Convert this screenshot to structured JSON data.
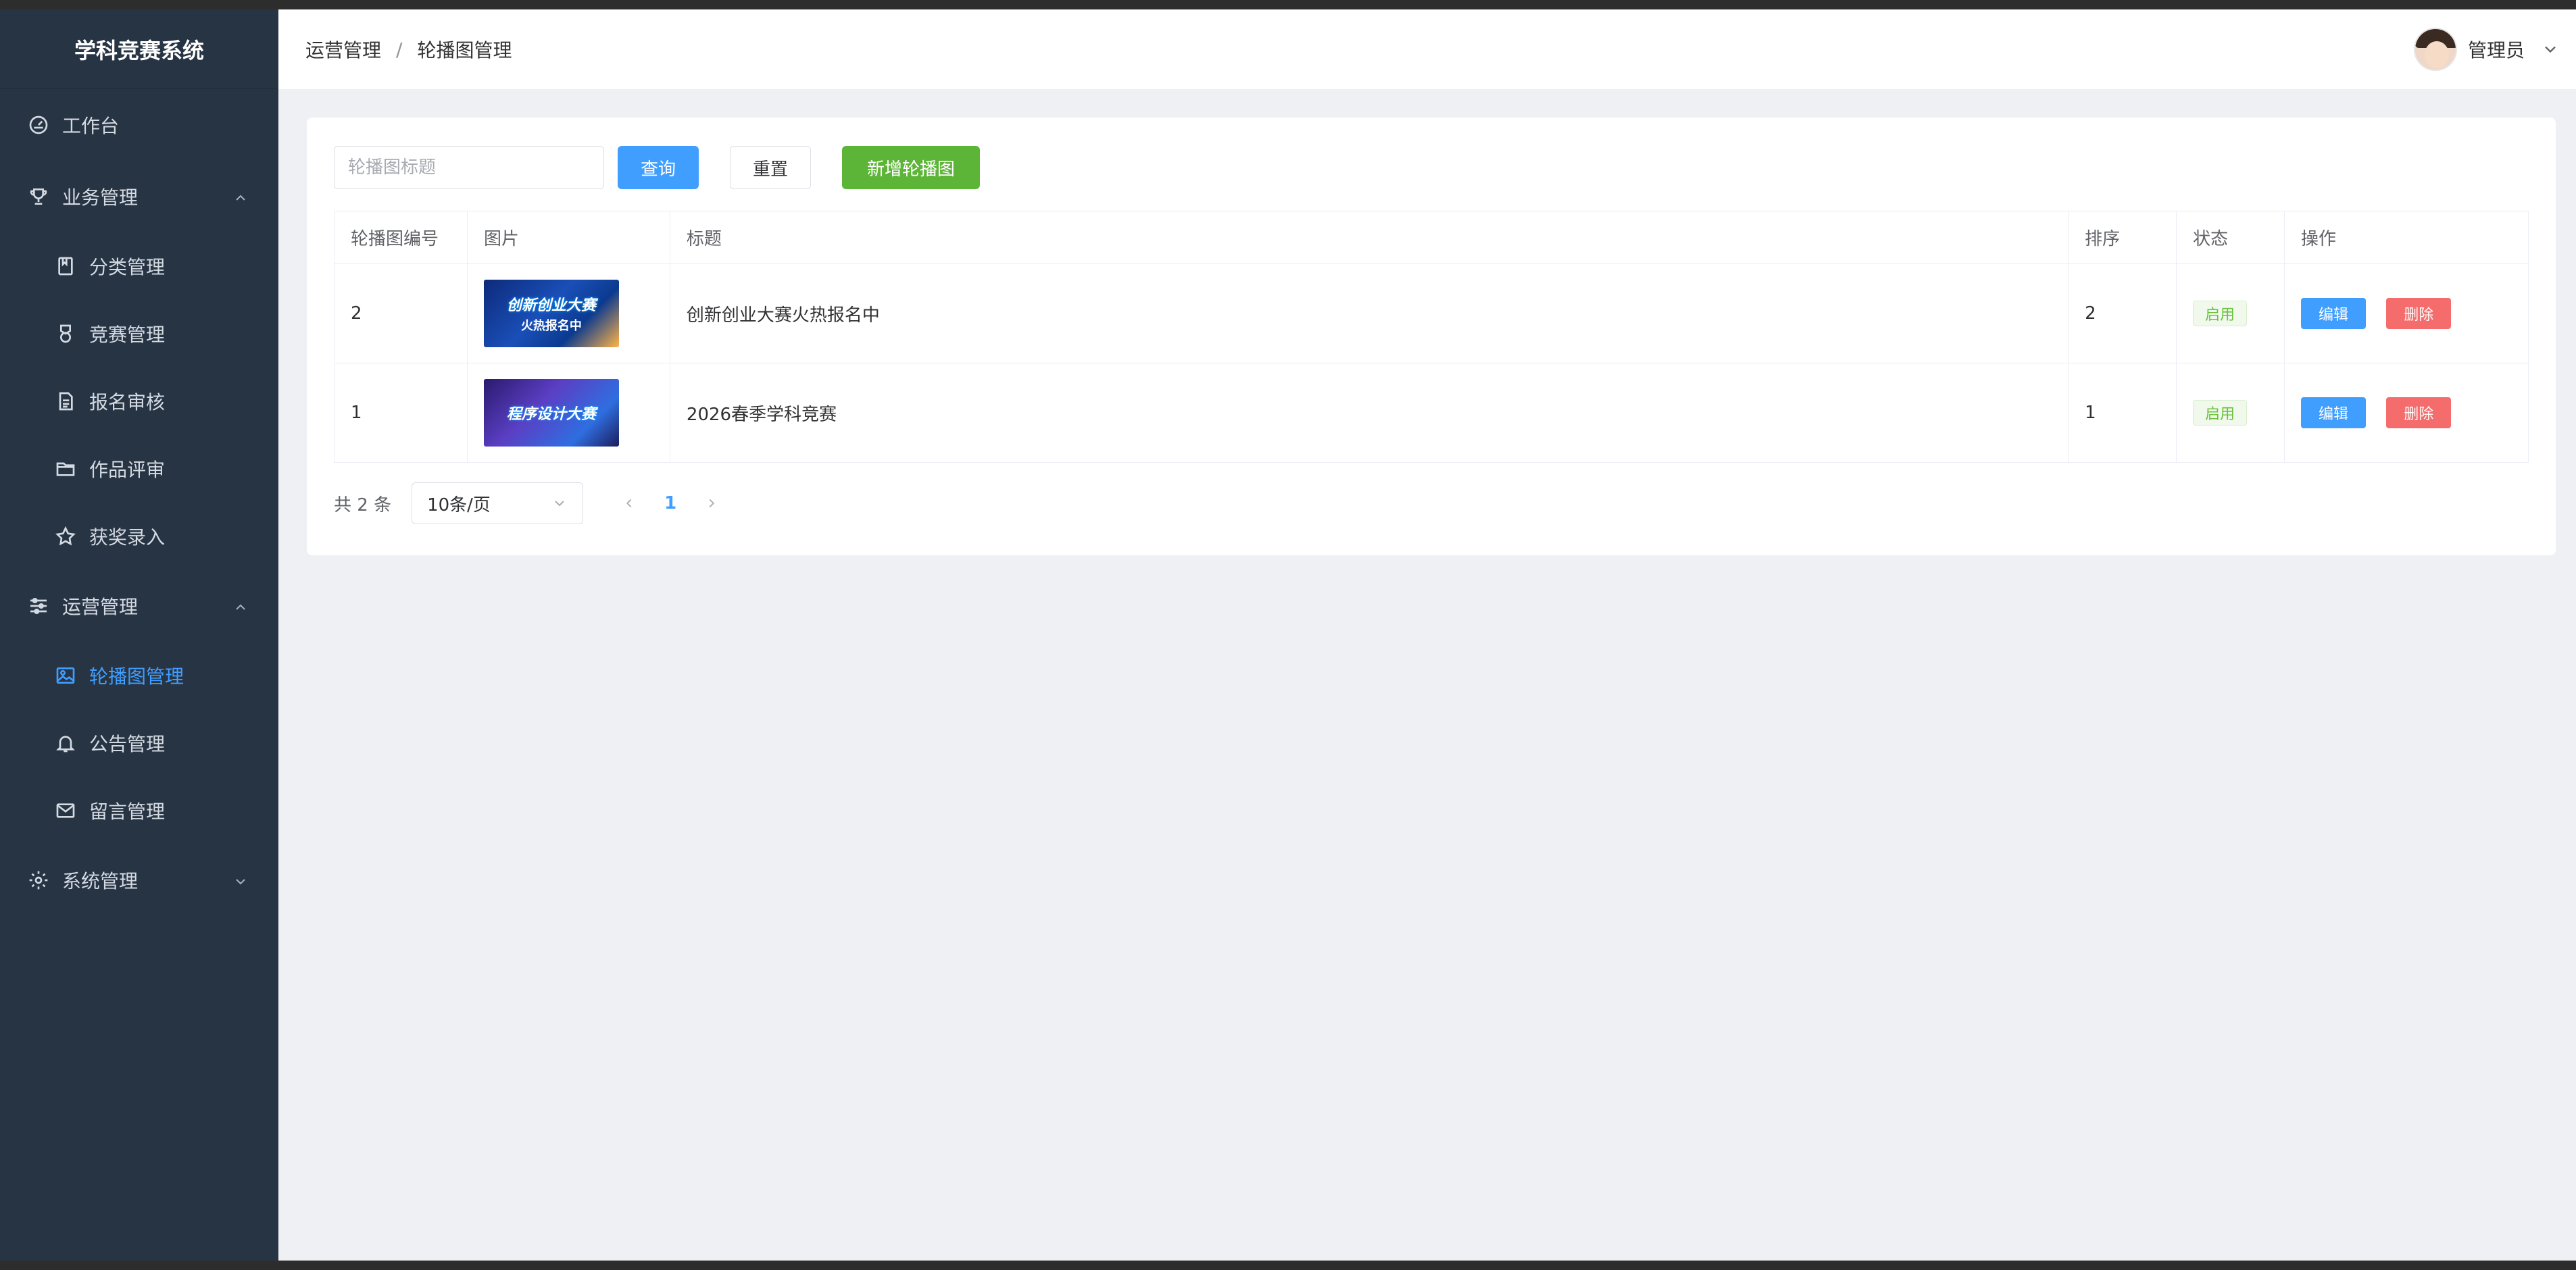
{
  "app": {
    "title": "学科竞赛系统"
  },
  "sidebar": {
    "items": [
      {
        "label": "工作台",
        "icon": "dashboard-icon"
      },
      {
        "label": "业务管理",
        "icon": "trophy-icon",
        "expanded": true
      },
      {
        "label": "分类管理",
        "icon": "book-icon"
      },
      {
        "label": "竞赛管理",
        "icon": "medal-icon"
      },
      {
        "label": "报名审核",
        "icon": "document-icon"
      },
      {
        "label": "作品评审",
        "icon": "folder-icon"
      },
      {
        "label": "获奖录入",
        "icon": "star-icon"
      },
      {
        "label": "运营管理",
        "icon": "sliders-icon",
        "expanded": true
      },
      {
        "label": "轮播图管理",
        "icon": "picture-icon",
        "active": true
      },
      {
        "label": "公告管理",
        "icon": "bell-icon"
      },
      {
        "label": "留言管理",
        "icon": "message-icon"
      },
      {
        "label": "系统管理",
        "icon": "gear-icon",
        "expanded": false
      }
    ]
  },
  "header": {
    "breadcrumb": [
      "运营管理",
      "轮播图管理"
    ],
    "separator": "/",
    "user_name": "管理员"
  },
  "toolbar": {
    "search_placeholder": "轮播图标题",
    "search_value": "",
    "query_label": "查询",
    "reset_label": "重置",
    "add_label": "新增轮播图"
  },
  "table": {
    "columns": [
      "轮播图编号",
      "图片",
      "标题",
      "排序",
      "状态",
      "操作"
    ],
    "rows": [
      {
        "id": "2",
        "image_line1": "创新创业大赛",
        "image_line2": "火热报名中",
        "title": "创新创业大赛火热报名中",
        "sort": "2",
        "status": "启用"
      },
      {
        "id": "1",
        "image_line1": "程序设计大赛",
        "image_line2": "",
        "title": "2026春季学科竞赛",
        "sort": "1",
        "status": "启用"
      }
    ],
    "edit_label": "编辑",
    "delete_label": "删除"
  },
  "pagination": {
    "total_text": "共 2 条",
    "page_size": "10条/页",
    "current_page": "1"
  },
  "colors": {
    "sidebar_bg": "#273444",
    "primary": "#409eff",
    "success": "#5cb536",
    "danger": "#f56c6c",
    "tag_green": "#67c23a"
  }
}
